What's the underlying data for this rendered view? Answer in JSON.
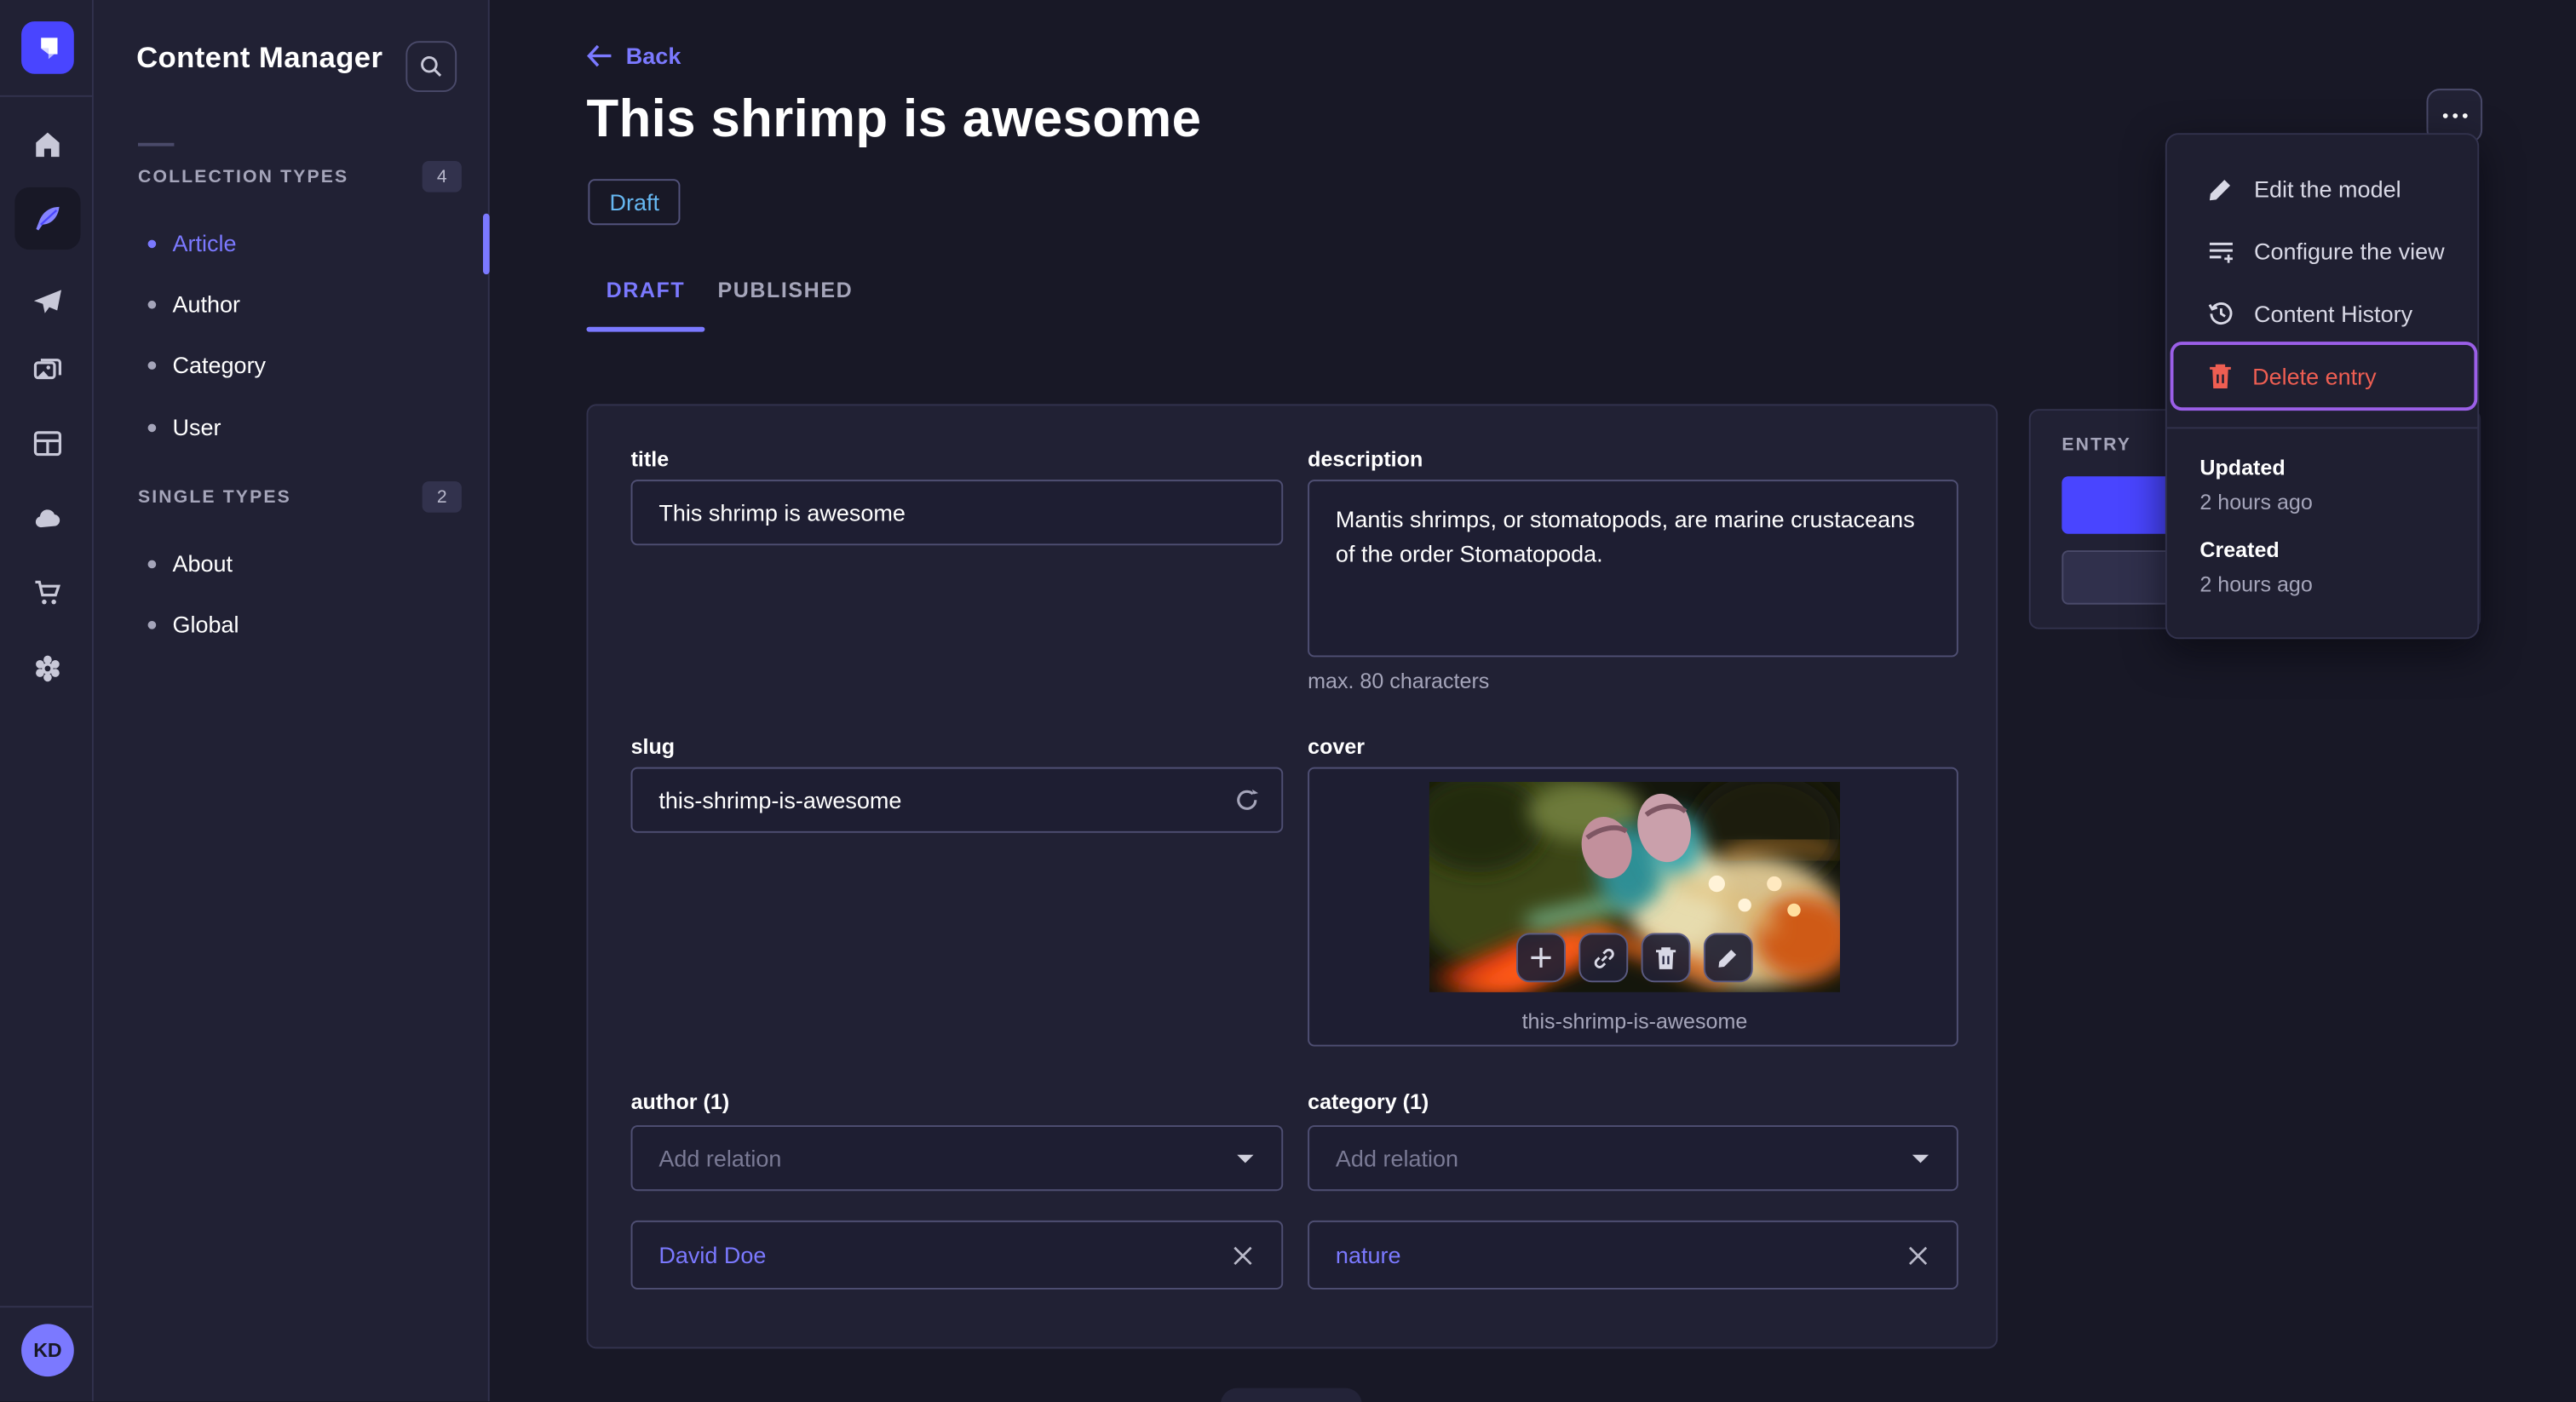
{
  "colors": {
    "background": "#181826",
    "panel": "#212134",
    "border": "#32324d",
    "accent": "#4945ff",
    "link": "#7b79ff",
    "danger": "#ee5e52",
    "draft_text": "#66b7f1",
    "focus_outline": "#9b5fe8",
    "subtle_text": "#a5a5ba"
  },
  "rail": {
    "avatar": "KD"
  },
  "subnav": {
    "title": "Content Manager",
    "sections": [
      {
        "label": "COLLECTION TYPES",
        "count": "4",
        "items": [
          {
            "label": "Article"
          },
          {
            "label": "Author"
          },
          {
            "label": "Category"
          },
          {
            "label": "User"
          }
        ]
      },
      {
        "label": "SINGLE TYPES",
        "count": "2",
        "items": [
          {
            "label": "About"
          },
          {
            "label": "Global"
          }
        ]
      }
    ]
  },
  "header": {
    "back": "Back",
    "title": "This shrimp is awesome",
    "status": "Draft",
    "tabs": [
      {
        "label": "DRAFT"
      },
      {
        "label": "PUBLISHED"
      }
    ]
  },
  "form": {
    "title": {
      "label": "title",
      "value": "This shrimp is awesome"
    },
    "description": {
      "label": "description",
      "value": "Mantis shrimps, or stomatopods, are marine crustaceans of the order Stomatopoda.",
      "hint": "max. 80 characters"
    },
    "slug": {
      "label": "slug",
      "value": "this-shrimp-is-awesome"
    },
    "cover": {
      "label": "cover",
      "caption": "this-shrimp-is-awesome"
    },
    "author": {
      "label": "author (1)",
      "placeholder": "Add relation",
      "relation": "David Doe"
    },
    "category": {
      "label": "category (1)",
      "placeholder": "Add relation",
      "relation": "nature"
    }
  },
  "entry_panel": {
    "title": "ENTRY"
  },
  "menu": {
    "items": [
      {
        "label": "Edit the model"
      },
      {
        "label": "Configure the view"
      },
      {
        "label": "Content History"
      },
      {
        "label": "Delete entry"
      }
    ],
    "updated_label": "Updated",
    "updated_value": "2 hours ago",
    "created_label": "Created",
    "created_value": "2 hours ago"
  }
}
